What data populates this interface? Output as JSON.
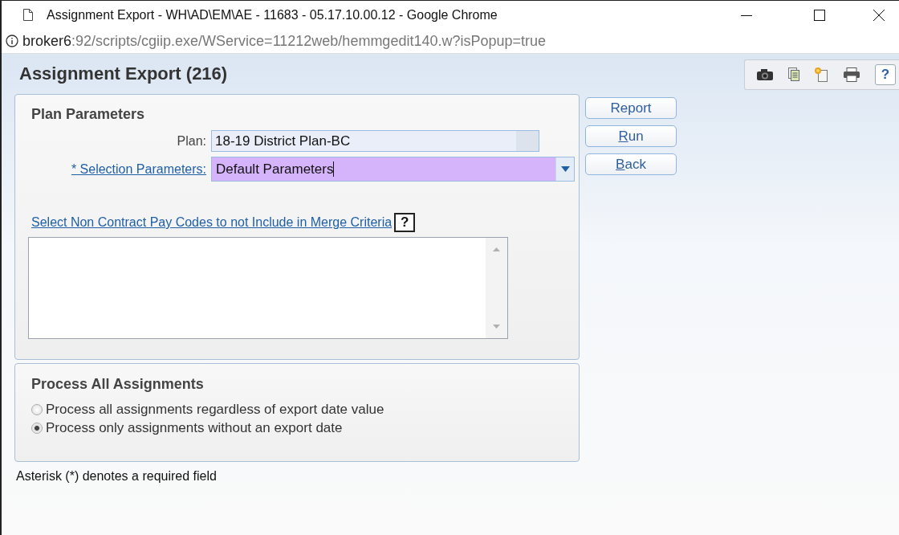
{
  "window": {
    "title": "Assignment Export - WH\\AD\\EM\\AE - 11683 - 05.17.10.00.12 - Google Chrome"
  },
  "address_bar": {
    "host": "broker6",
    "path": ":92/scripts/cgiip.exe/WService=11212web/hemmgedit140.w?isPopup=true"
  },
  "page": {
    "title": "Assignment Export (216)",
    "toolbar": [
      {
        "kind": "camera"
      },
      {
        "kind": "document"
      },
      {
        "kind": "new-document"
      },
      {
        "kind": "printer"
      },
      {
        "kind": "help",
        "label": "?"
      }
    ]
  },
  "plan_parameters": {
    "title": "Plan Parameters",
    "plan": {
      "label": "Plan:",
      "value": "18-19 District Plan-BC"
    },
    "selection": {
      "label": "* Selection Parameters:",
      "value": "Default Parameters",
      "focused": true
    },
    "pay_codes": {
      "label": "Select Non Contract Pay Codes to not Include in Merge Criteria",
      "help": "?"
    }
  },
  "buttons": [
    {
      "label": "Report",
      "mnemonic": false
    },
    {
      "label": "Run",
      "mnemonic": true
    },
    {
      "label": "Back",
      "mnemonic": true
    }
  ],
  "process_all": {
    "title": "Process All Assignments",
    "options": [
      {
        "label": "Process all assignments regardless of export date value",
        "selected": false
      },
      {
        "label": "Process only assignments without an export date",
        "selected": true
      }
    ]
  },
  "footnote": "Asterisk (*) denotes a required field"
}
